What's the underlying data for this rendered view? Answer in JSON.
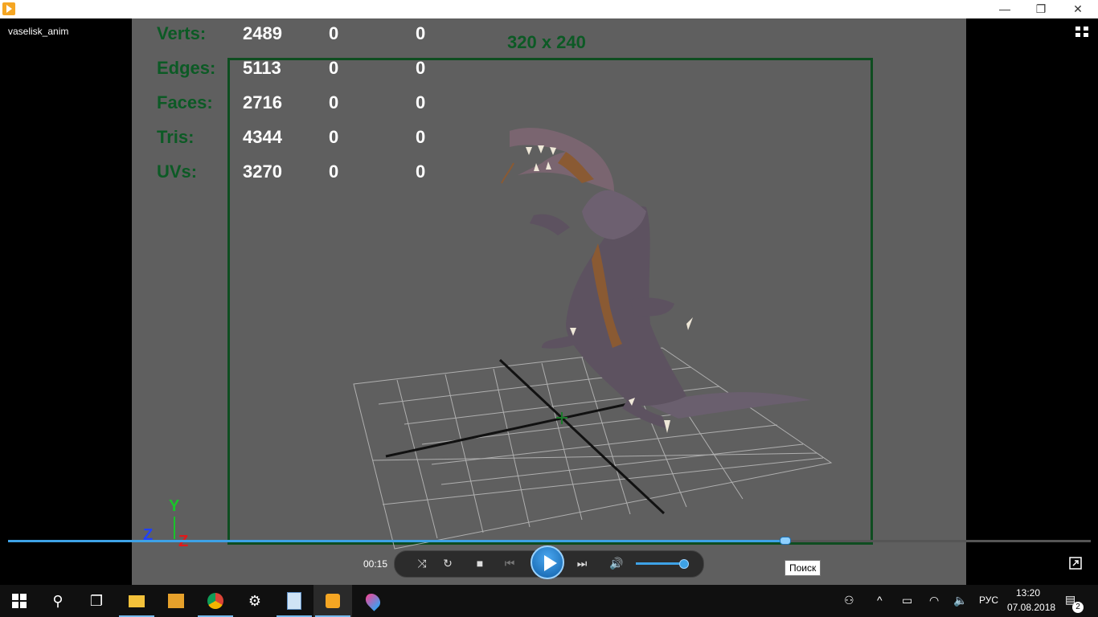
{
  "window": {
    "title": "vaselisk_anim"
  },
  "titlebar_buttons": {
    "minimize": "—",
    "restore": "❐",
    "close": "✕"
  },
  "video": {
    "stats": [
      {
        "label": "Verts:",
        "values": [
          "2489",
          "0",
          "0"
        ]
      },
      {
        "label": "Edges:",
        "values": [
          "5113",
          "0",
          "0"
        ]
      },
      {
        "label": "Faces:",
        "values": [
          "2716",
          "0",
          "0"
        ]
      },
      {
        "label": "Tris:",
        "values": [
          "4344",
          "0",
          "0"
        ]
      },
      {
        "label": "UVs:",
        "values": [
          "3270",
          "0",
          "0"
        ]
      }
    ],
    "resolution": "320 x 240",
    "axes": {
      "y": "Y",
      "z": "Z",
      "x": "Z"
    }
  },
  "player": {
    "time": "00:15",
    "seek_progress": 0.717,
    "volume_level": 0.9,
    "tooltip": "Поиск",
    "accent_color": "#3ea2e6"
  },
  "taskbar": {
    "language": "РУС",
    "time": "13:20",
    "date": "07.08.2018",
    "notification_count": "2"
  }
}
